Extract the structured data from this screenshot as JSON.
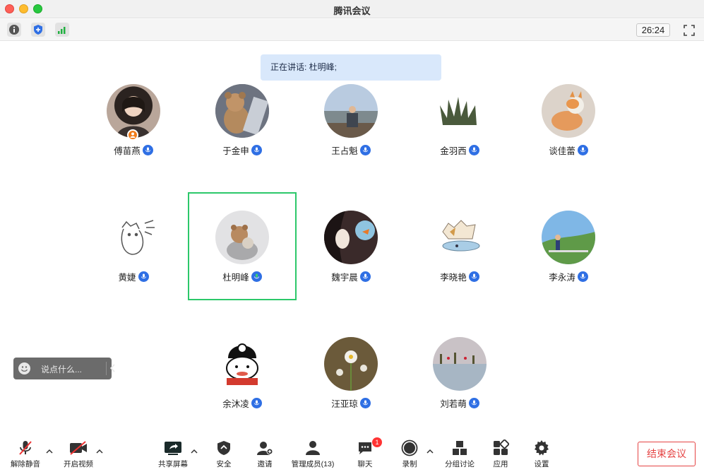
{
  "window": {
    "title": "腾讯会议"
  },
  "infobar": {
    "timer": "26:24"
  },
  "speaking": {
    "label": "正在讲话: 杜明峰;"
  },
  "participants": [
    {
      "name": "傅苗燕"
    },
    {
      "name": "于金申"
    },
    {
      "name": "王占魁"
    },
    {
      "name": "金羽西"
    },
    {
      "name": "谈佳蕾"
    },
    {
      "name": "黄婕"
    },
    {
      "name": "杜明峰"
    },
    {
      "name": "魏宇晨"
    },
    {
      "name": "李晓艳"
    },
    {
      "name": "李永涛"
    },
    {
      "name": "余沐凌"
    },
    {
      "name": "汪亚琼"
    },
    {
      "name": "刘若萌"
    }
  ],
  "chat": {
    "placeholder": "说点什么..."
  },
  "toolbar": {
    "unmute": "解除静音",
    "start_video": "开启视频",
    "share_screen": "共享屏幕",
    "security": "安全",
    "invite": "邀请",
    "members": "管理成员(13)",
    "chat": "聊天",
    "chat_badge": "1",
    "record": "录制",
    "breakout": "分组讨论",
    "apps": "应用",
    "settings": "设置",
    "end_meeting": "结束会议"
  },
  "colors": {
    "accent": "#2f6fe4",
    "end": "#e54444",
    "active_speaker": "#2cc86a",
    "banner": "#d9e8fb"
  }
}
